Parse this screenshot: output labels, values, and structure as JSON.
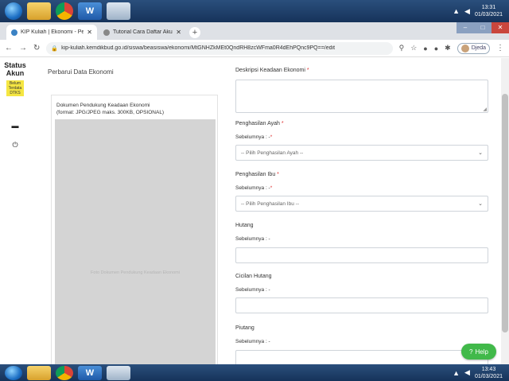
{
  "taskbar": {
    "apps": [
      {
        "icon": "windows-start-icon",
        "label": ""
      },
      {
        "icon": "folder-icon",
        "label": ""
      },
      {
        "icon": "chrome-icon",
        "label": ""
      },
      {
        "icon": "word-icon",
        "label": "W"
      },
      {
        "icon": "app-icon",
        "label": ""
      }
    ],
    "tray_top": {
      "time": "13:31",
      "date": "01/03/2021"
    },
    "tray_bottom": {
      "time": "13:43",
      "date": "01/03/2021"
    }
  },
  "browser": {
    "tabs": [
      {
        "title": "KIP Kuliah | Ekonomi - Perbarui D",
        "active": true
      },
      {
        "title": "Tutorial Cara Daftar Akun KIP K...",
        "active": false
      }
    ],
    "url": "kip-kuliah.kemdikbud.go.id/siswa/beasiswa/ekonomi/MtGNHZkMEt0QndRH8zcWFma0R4dEhPQnc9PQ==/edit",
    "profile_name": "Djeda"
  },
  "sidebar": {
    "status_title": "Status Akun",
    "status_badge": "Belum Terdata DTKS",
    "colors": {
      "badge": "#f5e642"
    }
  },
  "page": {
    "heading": "Perbarui Data Ekonomi",
    "upload": {
      "title_line1": "Dokumen Pendukung Keadaan Ekonomi",
      "title_line2": "(format: JPG/JPEG maks. 300KB, OPSIONAL)",
      "caption": "Foto Dokumen Pendukung Keadaan Ekonomi"
    },
    "form": {
      "deskripsi": {
        "label": "Deskripsi Keadaan Ekonomi",
        "required": "*"
      },
      "ayah": {
        "label": "Penghasilan Ayah",
        "required": "*",
        "previous": "Sebelumnya : -",
        "prev_required": "*",
        "placeholder": "-- Pilih Penghasilan Ayah --"
      },
      "ibu": {
        "label": "Penghasilan Ibu",
        "required": "*",
        "previous": "Sebelumnya : -",
        "prev_required": "*",
        "placeholder": "-- Pilih Penghasilan Ibu --"
      },
      "hutang": {
        "label": "Hutang",
        "previous": "Sebelumnya : -"
      },
      "cicilan": {
        "label": "Cicilan Hutang",
        "previous": "Sebelumnya : -"
      },
      "piutang": {
        "label": "Piutang",
        "previous": "Sebelumnya : -"
      }
    },
    "help_label": "Help",
    "colors": {
      "help": "#41b94a",
      "required": "#e03131"
    }
  }
}
